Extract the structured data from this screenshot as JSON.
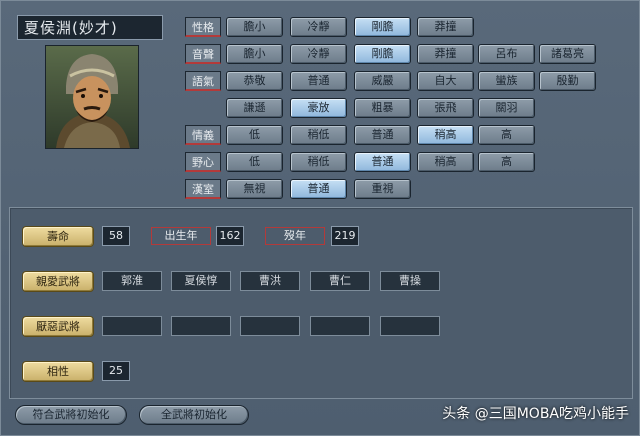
{
  "general_name": "夏侯淵(妙才)",
  "rows": {
    "personality": {
      "label": "性格",
      "options": [
        "膽小",
        "冷靜",
        "剛膽",
        "莽撞"
      ],
      "selected": 2
    },
    "voice": {
      "label": "音聲",
      "options": [
        "膽小",
        "冷靜",
        "剛膽",
        "莽撞",
        "呂布",
        "諸葛亮"
      ],
      "selected": 2
    },
    "tone": {
      "label": "語氣",
      "options": [
        "恭敬",
        "普通",
        "威嚴",
        "自大",
        "蠻族",
        "殷勤",
        "謙遜",
        "豪放",
        "粗暴",
        "張飛",
        "關羽"
      ],
      "selected": 7
    },
    "loyalty": {
      "label": "情義",
      "options": [
        "低",
        "稍低",
        "普通",
        "稍高",
        "高"
      ],
      "selected": 3
    },
    "ambition": {
      "label": "野心",
      "options": [
        "低",
        "稍低",
        "普通",
        "稍高",
        "高"
      ],
      "selected": 2
    },
    "han": {
      "label": "漢室",
      "options": [
        "無視",
        "普通",
        "重視"
      ],
      "selected": 1
    }
  },
  "stats": {
    "lifespan_label": "壽命",
    "lifespan_value": "58",
    "birth_label": "出生年",
    "birth_value": "162",
    "death_label": "歿年",
    "death_value": "219"
  },
  "relations": {
    "favored_label": "親愛武將",
    "favored": [
      "郭淮",
      "夏侯惇",
      "曹洪",
      "曹仁",
      "曹操"
    ],
    "disliked_label": "厭惡武將",
    "disliked": [
      "",
      "",
      "",
      "",
      ""
    ],
    "affinity_label": "相性",
    "affinity_value": "25"
  },
  "footer": {
    "reset_matching": "符合武將初始化",
    "reset_all": "全武將初始化"
  },
  "watermark": "头条 @三国MOBA吃鸡小能手",
  "colors": {
    "selected": "#a9cbea",
    "label_accent": "#b33a3a",
    "gold_button": "#dcc585"
  }
}
